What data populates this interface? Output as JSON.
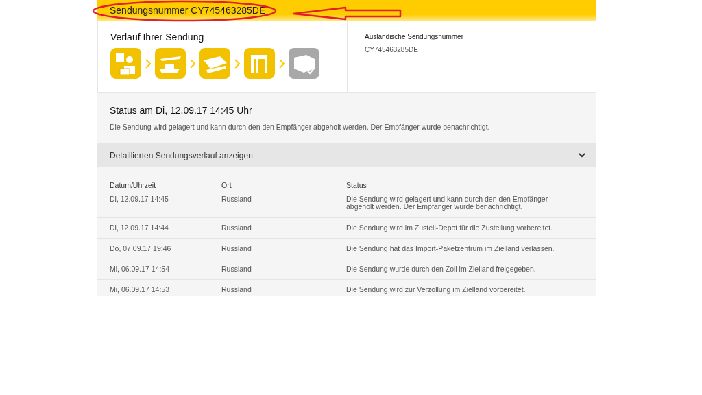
{
  "header": {
    "title": "Sendungsnummer CY745463285DE"
  },
  "progress": {
    "title": "Verlauf Ihrer Sendung",
    "steps": [
      {
        "kind": "pickup",
        "done": true
      },
      {
        "kind": "transport",
        "done": true
      },
      {
        "kind": "sorting",
        "done": true
      },
      {
        "kind": "customs",
        "done": true
      },
      {
        "kind": "delivered",
        "done": false
      }
    ]
  },
  "foreign_number": {
    "label": "Ausländische Sendungsnummer",
    "value": "CY745463285DE"
  },
  "status": {
    "title": "Status am Di, 12.09.17 14:45 Uhr",
    "text": "Die Sendung wird gelagert und kann durch den den Empfänger abgeholt werden. Der Empfänger wurde benachrichtigt."
  },
  "details_toggle": {
    "label": "Detaillierten Sendungsverlauf anzeigen"
  },
  "table": {
    "columns": [
      "Datum/Uhrzeit",
      "Ort",
      "Status"
    ],
    "rows": [
      [
        "Di, 12.09.17 14:45",
        "Russland",
        "Die Sendung wird gelagert und kann durch den den Empfänger abgeholt werden. Der Empfänger wurde benachrichtigt."
      ],
      [
        "Di, 12.09.17 14:44",
        "Russland",
        "Die Sendung wird im Zustell-Depot für die Zustellung vorbereitet."
      ],
      [
        "Do, 07.09.17 19:46",
        "Russland",
        "Die Sendung hat das Import-Paketzentrum im Zielland verlassen."
      ],
      [
        "Mi, 06.09.17 14:54",
        "Russland",
        "Die Sendung wurde durch den Zoll im Zielland freigegeben."
      ],
      [
        "Mi, 06.09.17 14:53",
        "Russland",
        "Die Sendung wird zur Verzollung im Zielland vorbereitet."
      ]
    ]
  }
}
